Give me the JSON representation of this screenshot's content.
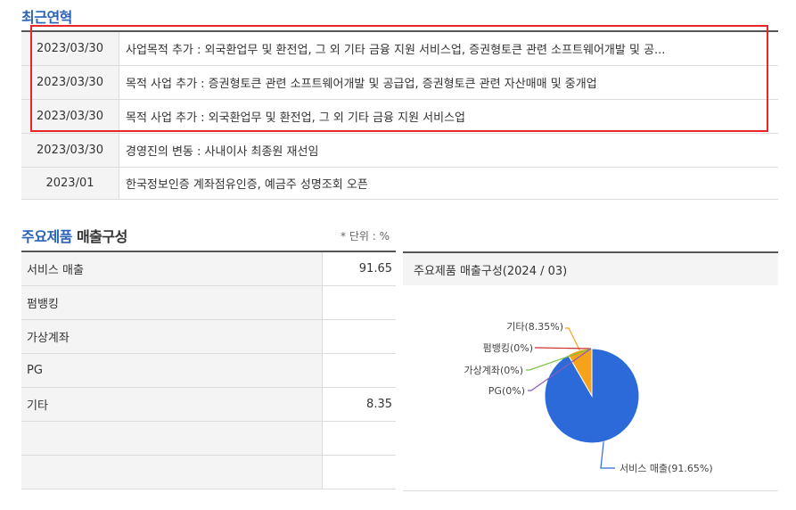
{
  "history": {
    "title": "최근연혁",
    "rows": [
      {
        "date": "2023/03/30",
        "desc": "사업목적 추가 : 외국환업무 및 환전업, 그 외 기타 금융 지원 서비스업, 증권형토큰 관련 소프트웨어개발 및 공..."
      },
      {
        "date": "2023/03/30",
        "desc": "목적 사업 추가 : 증권형토큰 관련 소프트웨어개발 및 공급업, 증권형토큰 관련 자산매매 및 중개업"
      },
      {
        "date": "2023/03/30",
        "desc": "목적 사업 추가 : 외국환업무 및 환전업, 그 외 기타 금융 지원 서비스업"
      },
      {
        "date": "2023/03/30",
        "desc": "경영진의 변동 : 사내이사 최종원 재선임"
      },
      {
        "date": "2023/01",
        "desc": "한국정보인증 계좌점유인증, 예금주 성명조회 오픈"
      }
    ]
  },
  "sales": {
    "title_accent": "주요제품",
    "title_rest": " 매출구성",
    "unit": "* 단위 : %",
    "rows": [
      {
        "label": "서비스 매출",
        "value": "91.65"
      },
      {
        "label": "펌뱅킹",
        "value": ""
      },
      {
        "label": "가상계좌",
        "value": ""
      },
      {
        "label": "PG",
        "value": ""
      },
      {
        "label": "기타",
        "value": "8.35"
      },
      {
        "label": "",
        "value": ""
      },
      {
        "label": "",
        "value": ""
      }
    ]
  },
  "chart_data": {
    "type": "pie",
    "title": "주요제품 매출구성(2024 / 03)",
    "categories": [
      "서비스 매출",
      "기타",
      "펌뱅킹",
      "가상계좌",
      "PG"
    ],
    "values": [
      91.65,
      8.35,
      0,
      0,
      0
    ],
    "labels": [
      "서비스 매출(91.65%)",
      "기타(8.35%)",
      "펌뱅킹(0%)",
      "가상계좌(0%)",
      "PG(0%)"
    ],
    "colors": [
      "#2b6ad8",
      "#f7a21b",
      "#c9302c",
      "#7cc242",
      "#8a5bb5"
    ]
  }
}
